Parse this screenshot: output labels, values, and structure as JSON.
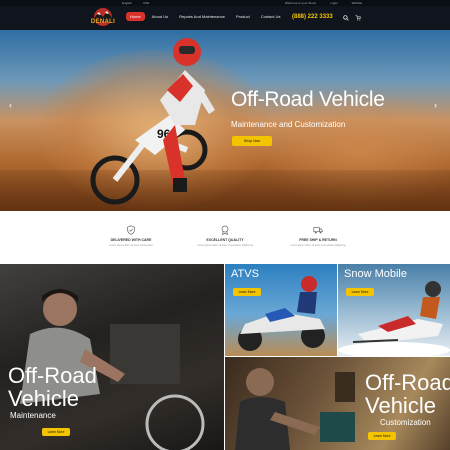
{
  "topbar": {
    "language": "English",
    "currency": "USD",
    "links": [
      "Welcome to your Store!",
      "Login",
      "Wishlist"
    ]
  },
  "header": {
    "logo_text": "DENALI",
    "nav": [
      {
        "label": "Home",
        "active": true
      },
      {
        "label": "About Us",
        "active": false
      },
      {
        "label": "Repairs And Maintenance",
        "active": false
      },
      {
        "label": "Product",
        "active": false
      },
      {
        "label": "Contact Us",
        "active": false
      }
    ],
    "phone": "(888) 222 3333",
    "icons": [
      "search-icon",
      "cart-icon"
    ]
  },
  "hero": {
    "title": "Off-Road Vehicle",
    "subtitle": "Maintenance and Customization",
    "button": "Shop Now",
    "prev_arrow": "‹",
    "next_arrow": "›"
  },
  "features": [
    {
      "icon": "shield-icon",
      "title": "DELIVERED WITH CARE",
      "desc": "Lorem ipsum dolor sit amet consectetur"
    },
    {
      "icon": "award-icon",
      "title": "EXCELLENT QUALITY",
      "desc": "Lorem ipsum dolor sit amet consectetur adipiscing"
    },
    {
      "icon": "truck-icon",
      "title": "FREE SHIP & RETURN",
      "desc": "Lorem ipsum dolor sit amet consectetur adipiscing"
    }
  ],
  "panels": {
    "maintenance": {
      "title_line1": "Off-Road",
      "title_line2": "Vehicle",
      "subtitle": "Maintenance",
      "button": "Learn More"
    },
    "atvs": {
      "title": "ATVS",
      "button": "Learn More"
    },
    "snow": {
      "title": "Snow Mobile",
      "button": "Learn More"
    },
    "custom": {
      "title_line1": "Off-Road",
      "title_line2": "Vehicle",
      "subtitle": "Customization",
      "button": "Learn More"
    }
  },
  "colors": {
    "accent": "#f5c400",
    "nav_active": "#d9322a",
    "header_bg": "#10151d"
  }
}
